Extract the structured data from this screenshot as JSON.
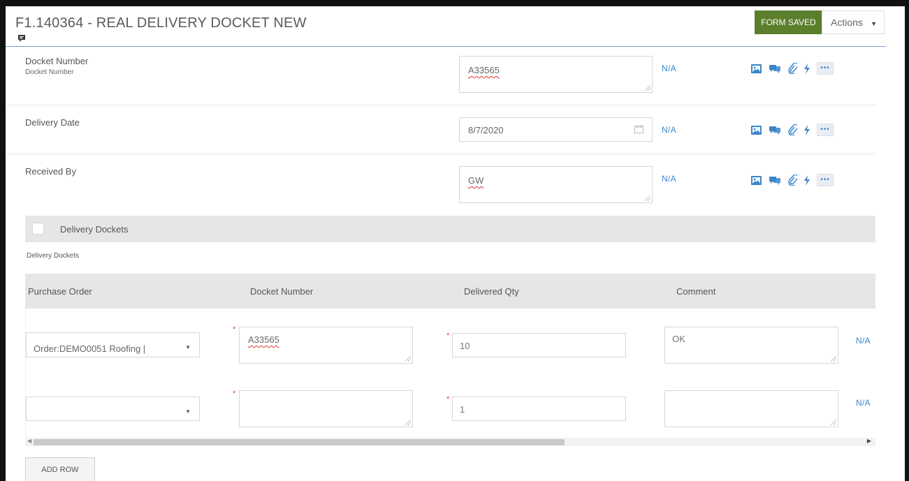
{
  "form": {
    "title": "F1.140364 - REAL DELIVERY DOCKET NEW",
    "saved_label": "FORM SAVED",
    "actions_label": "Actions"
  },
  "fields": [
    {
      "label": "Docket Number",
      "sublabel": "Docket Number",
      "value": "A33565",
      "na": "N/A"
    },
    {
      "label": "Delivery Date",
      "value": "8/7/2020",
      "na": "N/A"
    },
    {
      "label": "Received By",
      "value": "GW",
      "na": "N/A"
    }
  ],
  "field_tools": [
    "image-icon",
    "comment-icon",
    "paperclip-icon",
    "lightning-icon",
    "more-icon"
  ],
  "section": {
    "title": "Delivery Dockets",
    "subtitle": "Delivery Dockets"
  },
  "grid": {
    "columns": [
      "Purchase Order",
      "Docket Number",
      "Delivered Qty",
      "Comment"
    ],
    "rows": [
      {
        "purchase_order": "Order:DEMO0051 Roofing |",
        "docket_number": "A33565",
        "delivered_qty": "10",
        "comment": "OK",
        "na": "N/A"
      },
      {
        "purchase_order": "",
        "docket_number": "",
        "delivered_qty": "1",
        "comment": "",
        "na": "N/A"
      }
    ],
    "required_mark": "*"
  },
  "add_row_label": "ADD ROW",
  "colors": {
    "accent_blue": "#3a86c8",
    "saved_green": "#5b7e2d",
    "required_red": "#e53e3e",
    "panel_gray": "#e6e6e6"
  }
}
